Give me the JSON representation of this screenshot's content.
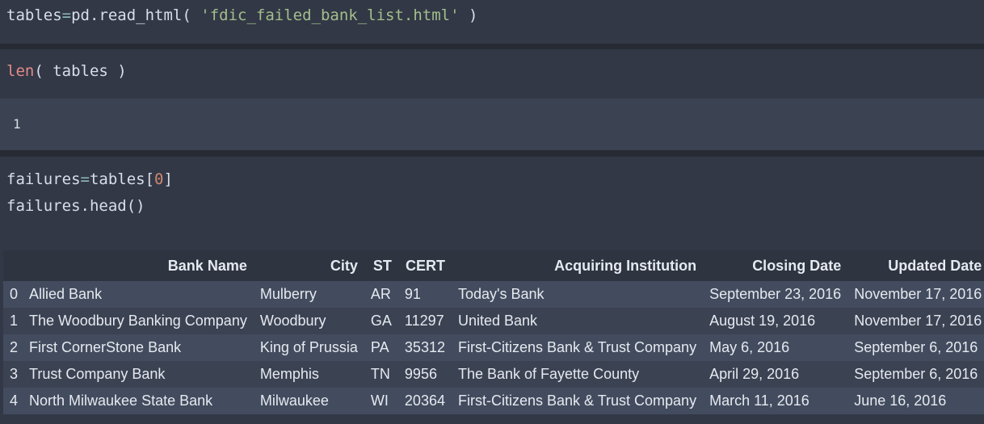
{
  "cells": {
    "c1": {
      "var": "tables",
      "op": "=",
      "call": "pd.read_html( ",
      "arg": "'fdic_failed_bank_list.html'",
      "close": " )"
    },
    "c2": {
      "fn": "len",
      "rest": "( tables )"
    },
    "c2_output": "1",
    "c3": {
      "line1_var": "failures",
      "line1_op": "=",
      "line1_obj": "tables[",
      "line1_idx": "0",
      "line1_close": "]",
      "line2": "failures.head()"
    }
  },
  "dataframe": {
    "columns": [
      "",
      "Bank Name",
      "City",
      "ST",
      "CERT",
      "Acquiring Institution",
      "Closing Date",
      "Updated Date"
    ],
    "rows": [
      [
        "0",
        "Allied Bank",
        "Mulberry",
        "AR",
        "91",
        "Today's Bank",
        "September 23, 2016",
        "November 17, 2016"
      ],
      [
        "1",
        "The Woodbury Banking Company",
        "Woodbury",
        "GA",
        "11297",
        "United Bank",
        "August 19, 2016",
        "November 17, 2016"
      ],
      [
        "2",
        "First CornerStone Bank",
        "King of Prussia",
        "PA",
        "35312",
        "First-Citizens Bank & Trust Company",
        "May 6, 2016",
        "September 6, 2016"
      ],
      [
        "3",
        "Trust Company Bank",
        "Memphis",
        "TN",
        "9956",
        "The Bank of Fayette County",
        "April 29, 2016",
        "September 6, 2016"
      ],
      [
        "4",
        "North Milwaukee State Bank",
        "Milwaukee",
        "WI",
        "20364",
        "First-Citizens Bank & Trust Company",
        "March 11, 2016",
        "June 16, 2016"
      ]
    ]
  },
  "colors": {
    "background": "#2b303b",
    "cell": "#323846",
    "string": "#a3be8c",
    "function": "#e38a8a",
    "number": "#d08770",
    "operator": "#8fbcbb"
  }
}
